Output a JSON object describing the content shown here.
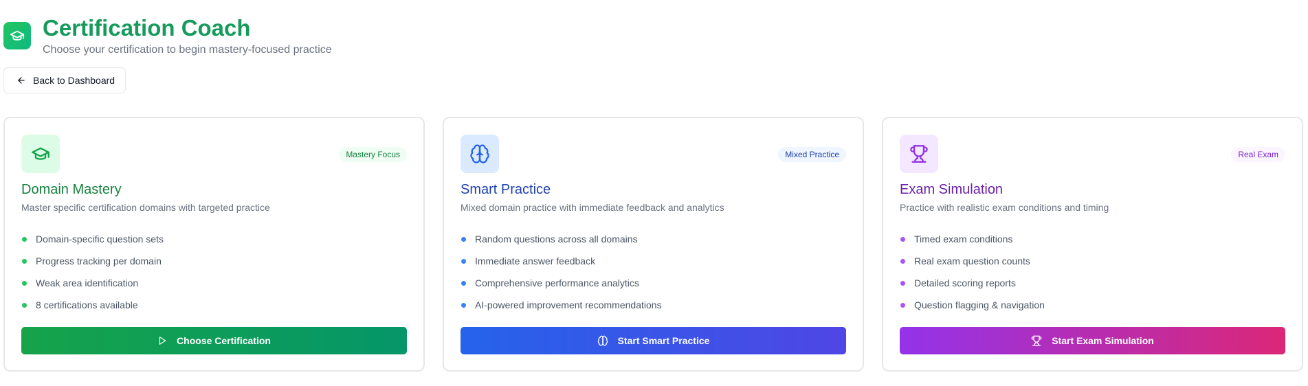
{
  "header": {
    "title": "Certification Coach",
    "subtitle": "Choose your certification to begin mastery-focused practice",
    "logo_icon": "graduation-cap-icon"
  },
  "back_button": {
    "label": "Back to Dashboard",
    "icon": "arrow-left-icon"
  },
  "cards": [
    {
      "title": "Domain Mastery",
      "description": "Master specific certification domains with targeted practice",
      "badge": "Mastery Focus",
      "icon": "graduation-cap-icon",
      "accent": "#16a34a",
      "features": [
        "Domain-specific question sets",
        "Progress tracking per domain",
        "Weak area identification",
        "8 certifications available"
      ],
      "action_label": "Choose Certification",
      "action_icon": "play-icon"
    },
    {
      "title": "Smart Practice",
      "description": "Mixed domain practice with immediate feedback and analytics",
      "badge": "Mixed Practice",
      "icon": "brain-icon",
      "accent": "#2563eb",
      "features": [
        "Random questions across all domains",
        "Immediate answer feedback",
        "Comprehensive performance analytics",
        "AI-powered improvement recommendations"
      ],
      "action_label": "Start Smart Practice",
      "action_icon": "brain-icon"
    },
    {
      "title": "Exam Simulation",
      "description": "Practice with realistic exam conditions and timing",
      "badge": "Real Exam",
      "icon": "trophy-icon",
      "accent": "#9333ea",
      "features": [
        "Timed exam conditions",
        "Real exam question counts",
        "Detailed scoring reports",
        "Question flagging & navigation"
      ],
      "action_label": "Start Exam Simulation",
      "action_icon": "trophy-icon"
    }
  ]
}
